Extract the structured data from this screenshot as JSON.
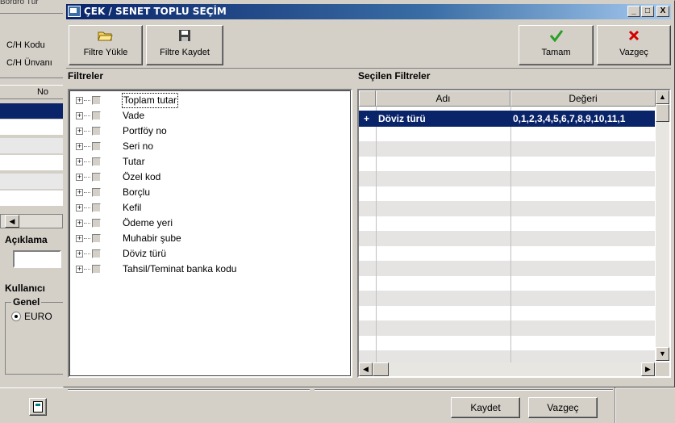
{
  "background": {
    "cut_top_text": "Bordro Tür",
    "ch_kodu": "C/H Kodu",
    "ch_unvani": "C/H Ünvanı",
    "grid_header": "No",
    "aciklama": "Açıklama",
    "kullanici": "Kullanıcı",
    "genel": "Genel",
    "radio_label": "EURO",
    "save_button": "Kaydet",
    "cancel_button": "Vazgeç"
  },
  "dialog": {
    "title": "ÇEK / SENET TOPLU SEÇİM",
    "caption_buttons": [
      "_",
      "□",
      "X"
    ],
    "toolbar": {
      "load_filter": "Filtre Yükle",
      "save_filter": "Filtre Kaydet",
      "ok": "Tamam",
      "cancel": "Vazgeç"
    },
    "filters_title": "Filtreler",
    "selected_title": "Seçilen Filtreler",
    "filters": [
      "Toplam tutar",
      "Vade",
      "Portföy no",
      "Seri no",
      "Tutar",
      "Özel kod",
      "Borçlu",
      "Kefil",
      "Ödeme yeri",
      "Muhabir şube",
      "Döviz türü",
      "Tahsil/Teminat banka kodu"
    ],
    "grid": {
      "col_name": "Adı",
      "col_value": "Değeri",
      "rows": [
        {
          "indicator": "+",
          "name": "Döviz türü",
          "value": "0,1,2,3,4,5,6,7,8,9,10,11,1"
        }
      ]
    }
  },
  "icons": {
    "load": "folder-open-icon",
    "save": "floppy-disk-icon",
    "ok": "checkmark-icon",
    "cancel": "red-x-icon"
  },
  "colors": {
    "selection": "#0a246a",
    "ok_green": "#2aa02a",
    "cancel_red": "#d40000"
  }
}
